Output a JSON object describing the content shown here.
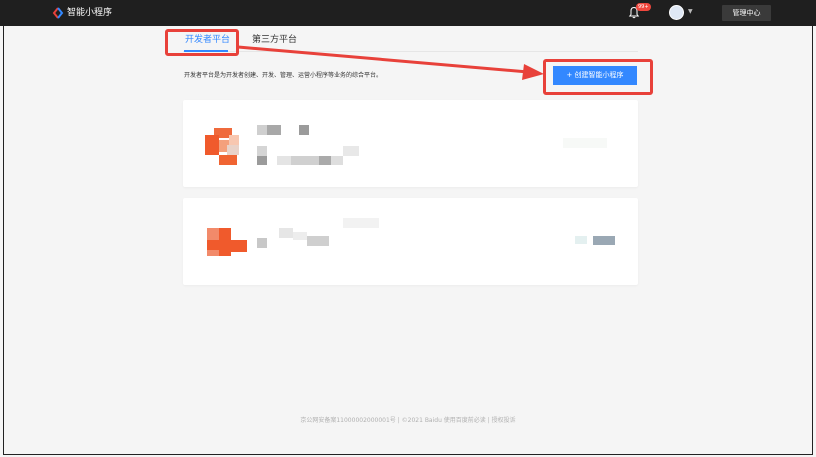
{
  "header": {
    "app_title": "智能小程序",
    "notification_badge": "99+",
    "manage_center_label": "管理中心"
  },
  "tabs": [
    {
      "label": "开发者平台",
      "active": true
    },
    {
      "label": "第三方平台",
      "active": false
    }
  ],
  "main": {
    "description": "开发者平台是为开发者创建、开发、管理、运营小程序等业务的综合平台。",
    "create_button_label": "+ 创建智能小程序"
  },
  "footer": {
    "text": "京公网安备案11000002000001号 | ©2021 Baidu 使用百度前必读 | 授权投诉"
  },
  "colors": {
    "accent": "#3388ff",
    "annotation": "#e8413a",
    "topbar": "#1f1f1f"
  }
}
